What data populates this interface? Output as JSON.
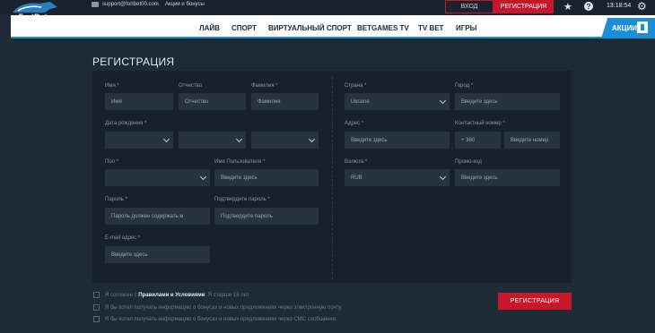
{
  "header": {
    "logo_text": "FortBet",
    "email": "support@fortbet00.com",
    "promo_link": "Акции и бонусы",
    "login": "ВХОД",
    "register": "РЕГИСТРАЦИЯ",
    "time": "13:18:54"
  },
  "nav": {
    "items": [
      "ЛАЙВ",
      "СПОРТ",
      "ВИРТУАЛЬНЫЙ СПОРТ",
      "BETGAMES TV",
      "TV BET",
      "ИГРЫ"
    ],
    "promo_tab": "АКЦИИ"
  },
  "form": {
    "title": "РЕГИСТРАЦИЯ",
    "first_name": {
      "label": "Имя *",
      "placeholder": "Имя"
    },
    "patronymic": {
      "label": "Отчество",
      "placeholder": "Отчество"
    },
    "last_name": {
      "label": "Фамилия *",
      "placeholder": "Фамилия"
    },
    "birth_date": {
      "label": "Дата рождения *"
    },
    "gender": {
      "label": "Пол *"
    },
    "username": {
      "label": "Имя Пользователя *",
      "placeholder": "Введите здесь"
    },
    "password": {
      "label": "Пароль *",
      "placeholder": "Пароль должен содержать м"
    },
    "confirm_password": {
      "label": "Подтвердите пароль *",
      "placeholder": "Подтвердите пароль"
    },
    "email": {
      "label": "E-mail адрес *",
      "placeholder": "Введите здесь"
    },
    "country": {
      "label": "Страна *",
      "value": "Ukraine"
    },
    "city": {
      "label": "Город *",
      "placeholder": "Введите здесь"
    },
    "address": {
      "label": "Адрес *",
      "placeholder": "Введите здесь"
    },
    "phone": {
      "label": "Контактный номер *",
      "code": "+ 380",
      "placeholder": "Введите номер"
    },
    "currency": {
      "label": "Валюта *",
      "value": "RUB"
    },
    "promo_code": {
      "label": "Промо-код",
      "placeholder": "Введите здесь"
    },
    "agree": {
      "prefix": "Я согласен с ",
      "link": "Правилами и Условиями",
      "suffix": ". Я старше 18 лет"
    },
    "newsletter_email": "Я бы хотел получать информацию о бонусах и новых предложениях через электронную почту",
    "newsletter_sms": "Я бы хотел получать информацию о бонусах и новых предложениях через СМС сообщения.",
    "submit": "РЕГИСТРАЦИЯ"
  },
  "colors": {
    "accent_red": "#c6182a",
    "accent_blue": "#1a8fd6",
    "panel": "#18212b",
    "input": "#273340"
  }
}
